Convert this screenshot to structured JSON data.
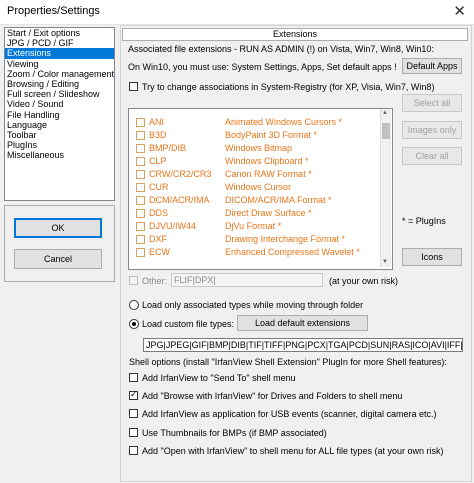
{
  "window": {
    "title": "Properties/Settings",
    "close_glyph": "✕"
  },
  "sidebar": {
    "items": [
      "Start / Exit options",
      "JPG / PCD / GIF",
      "Extensions",
      "Viewing",
      "Zoom / Color management",
      "Browsing / Editing",
      "Full screen / Slideshow",
      "Video / Sound",
      "File Handling",
      "Language",
      "Toolbar",
      "PlugIns",
      "Miscellaneous"
    ],
    "selected_index": 2
  },
  "buttons": {
    "ok": "OK",
    "cancel": "Cancel"
  },
  "extensions": {
    "header": "Extensions",
    "assoc_line": "Associated file extensions - RUN AS ADMIN (!) on Vista, Win7, Win8, Win10:",
    "win10_line": "On Win10, you must use: System Settings, Apps, Set default apps !",
    "default_apps": "Default Apps",
    "try_change": "Try to change associations in System-Registry (for XP, Visia, Win7, Win8)",
    "select_all": "Select all",
    "images_only": "Images only",
    "clear_all": "Clear all",
    "plugins_note": "* = PlugIns",
    "icons": "Icons",
    "types": [
      {
        "ext": "ANI",
        "desc": "Animated Windows Cursors *"
      },
      {
        "ext": "B3D",
        "desc": "BodyPaint 3D Format *"
      },
      {
        "ext": "BMP/DIB",
        "desc": "Windows Bitmap"
      },
      {
        "ext": "CLP",
        "desc": "Windows Clipboard *"
      },
      {
        "ext": "CRW/CR2/CR3",
        "desc": "Canon RAW Format *"
      },
      {
        "ext": "CUR",
        "desc": "Windows Cursor"
      },
      {
        "ext": "DCM/ACR/IMA",
        "desc": "DICOM/ACR/IMA Format *"
      },
      {
        "ext": "DDS",
        "desc": "Direct Draw Surface *"
      },
      {
        "ext": "DJVU/IW44",
        "desc": "DjVu Format *"
      },
      {
        "ext": "DXF",
        "desc": "Drawing Interchange Format *"
      },
      {
        "ext": "ECW",
        "desc": "Enhanced Compressed Wavelet *"
      }
    ],
    "other_label": "Other:",
    "other_value": "FLIF|DPX|",
    "other_note": "(at your own risk)",
    "load_assoc": "Load only associated types while moving through folder",
    "load_custom": "Load custom file types:",
    "load_default_ext": "Load default extensions",
    "custom_value": "JPG|JPEG|GIF|BMP|DIB|TIF|TIFF|PNG|PCX|TGA|PCD|SUN|RAS|ICO|AVI|IFF|PN",
    "shell_heading": "Shell options (install \"IrfanView Shell Extension\" PlugIn for more Shell features):",
    "shell_options": [
      {
        "label": "Add IrfanView to \"Send To\" shell menu",
        "checked": false
      },
      {
        "label": "Add \"Browse with IrfanView\" for Drives and Folders to shell menu",
        "checked": true
      },
      {
        "label": "Add IrfanView as application for USB events (scanner, digital camera etc.)",
        "checked": false
      },
      {
        "label": "Use Thumbnails for BMPs (if BMP associated)",
        "checked": false
      },
      {
        "label": "Add \"Open with IrfanView\" to shell menu for ALL file types (at your own risk)",
        "checked": false
      }
    ]
  },
  "colors": {
    "accent": "#0078d7",
    "type_text": "#e8751a"
  }
}
